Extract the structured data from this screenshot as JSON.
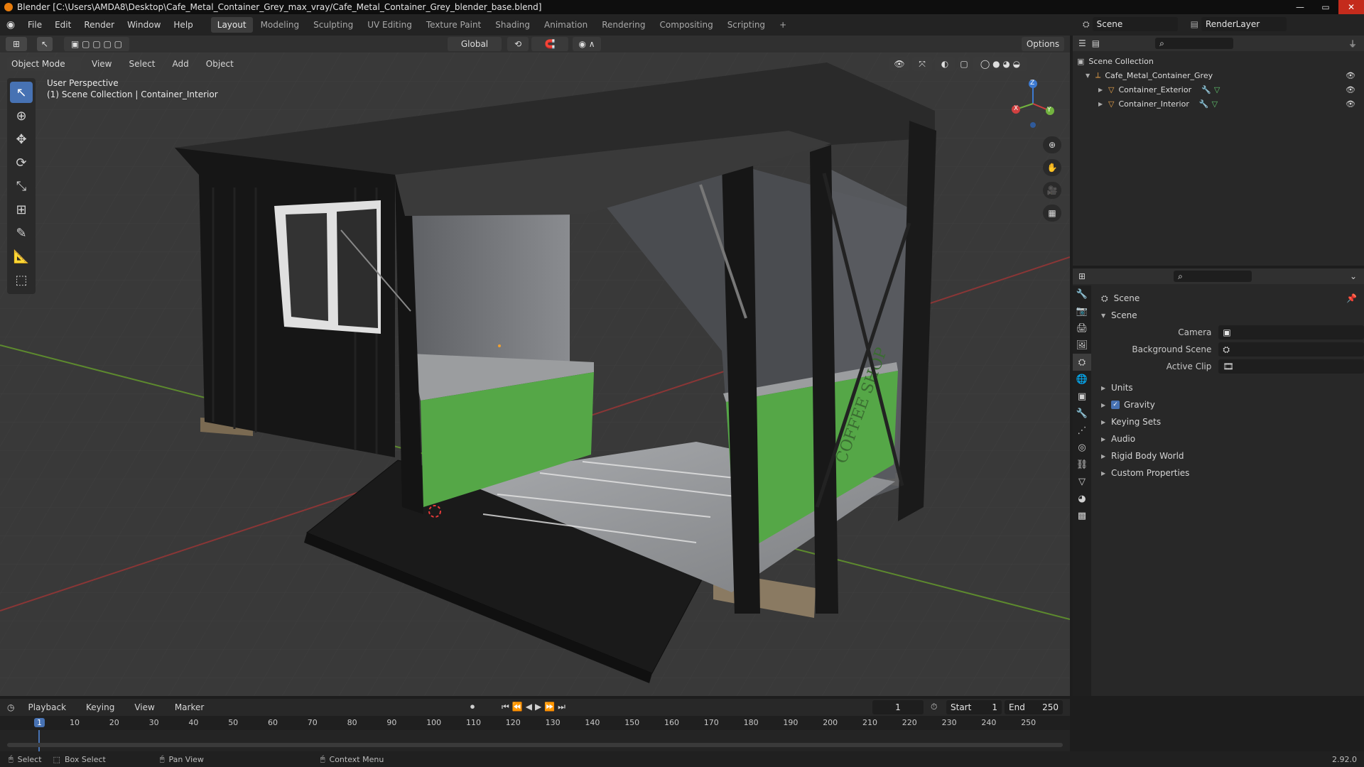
{
  "title_bar": {
    "text": "Blender [C:\\Users\\AMDA8\\Desktop\\Cafe_Metal_Container_Grey_max_vray/Cafe_Metal_Container_Grey_blender_base.blend]",
    "min": "—",
    "max": "▭",
    "close": "✕"
  },
  "menu": [
    "File",
    "Edit",
    "Render",
    "Window",
    "Help"
  ],
  "workspaces": [
    "Layout",
    "Modeling",
    "Sculpting",
    "UV Editing",
    "Texture Paint",
    "Shading",
    "Animation",
    "Rendering",
    "Compositing",
    "Scripting"
  ],
  "workspace_add": "+",
  "scene_selector": {
    "scene": "Scene",
    "render_layer": "RenderLayer"
  },
  "tool_header": {
    "orientation": "Global",
    "options": "Options"
  },
  "viewport_header": {
    "mode": "Object Mode",
    "menus": [
      "View",
      "Select",
      "Add",
      "Object"
    ]
  },
  "viewport_overlay": {
    "perspective": "User Perspective",
    "context": "(1) Scene Collection | Container_Interior"
  },
  "gizmo_axes": {
    "x": "X",
    "y": "Y",
    "z": "Z"
  },
  "outliner": {
    "root": "Scene Collection",
    "items": [
      {
        "name": "Cafe_Metal_Container_Grey",
        "level": 1
      },
      {
        "name": "Container_Exterior",
        "level": 2
      },
      {
        "name": "Container_Interior",
        "level": 2
      }
    ]
  },
  "properties": {
    "context_title": "Scene",
    "panel_title": "Scene",
    "fields": [
      {
        "label": "Camera",
        "value": ""
      },
      {
        "label": "Background Scene",
        "value": ""
      },
      {
        "label": "Active Clip",
        "value": ""
      }
    ],
    "sections": [
      "Units",
      "Gravity",
      "Keying Sets",
      "Audio",
      "Rigid Body World",
      "Custom Properties"
    ],
    "gravity_checked": true
  },
  "timeline": {
    "menus": [
      "Playback",
      "Keying",
      "View",
      "Marker"
    ],
    "current_frame": "1",
    "start_label": "Start",
    "start": "1",
    "end_label": "End",
    "end": "250",
    "ruler": [
      "1",
      "10",
      "20",
      "30",
      "40",
      "50",
      "60",
      "70",
      "80",
      "90",
      "100",
      "110",
      "120",
      "130",
      "140",
      "150",
      "160",
      "170",
      "180",
      "190",
      "200",
      "210",
      "220",
      "230",
      "240",
      "250"
    ]
  },
  "statusbar": {
    "select": "Select",
    "box_select": "Box Select",
    "pan_view": "Pan View",
    "context_menu": "Context Menu",
    "version": "2.92.0"
  },
  "colors": {
    "accent": "#4772b3",
    "counter_green": "#5aa84a",
    "container_dark": "#1b1b1b"
  }
}
